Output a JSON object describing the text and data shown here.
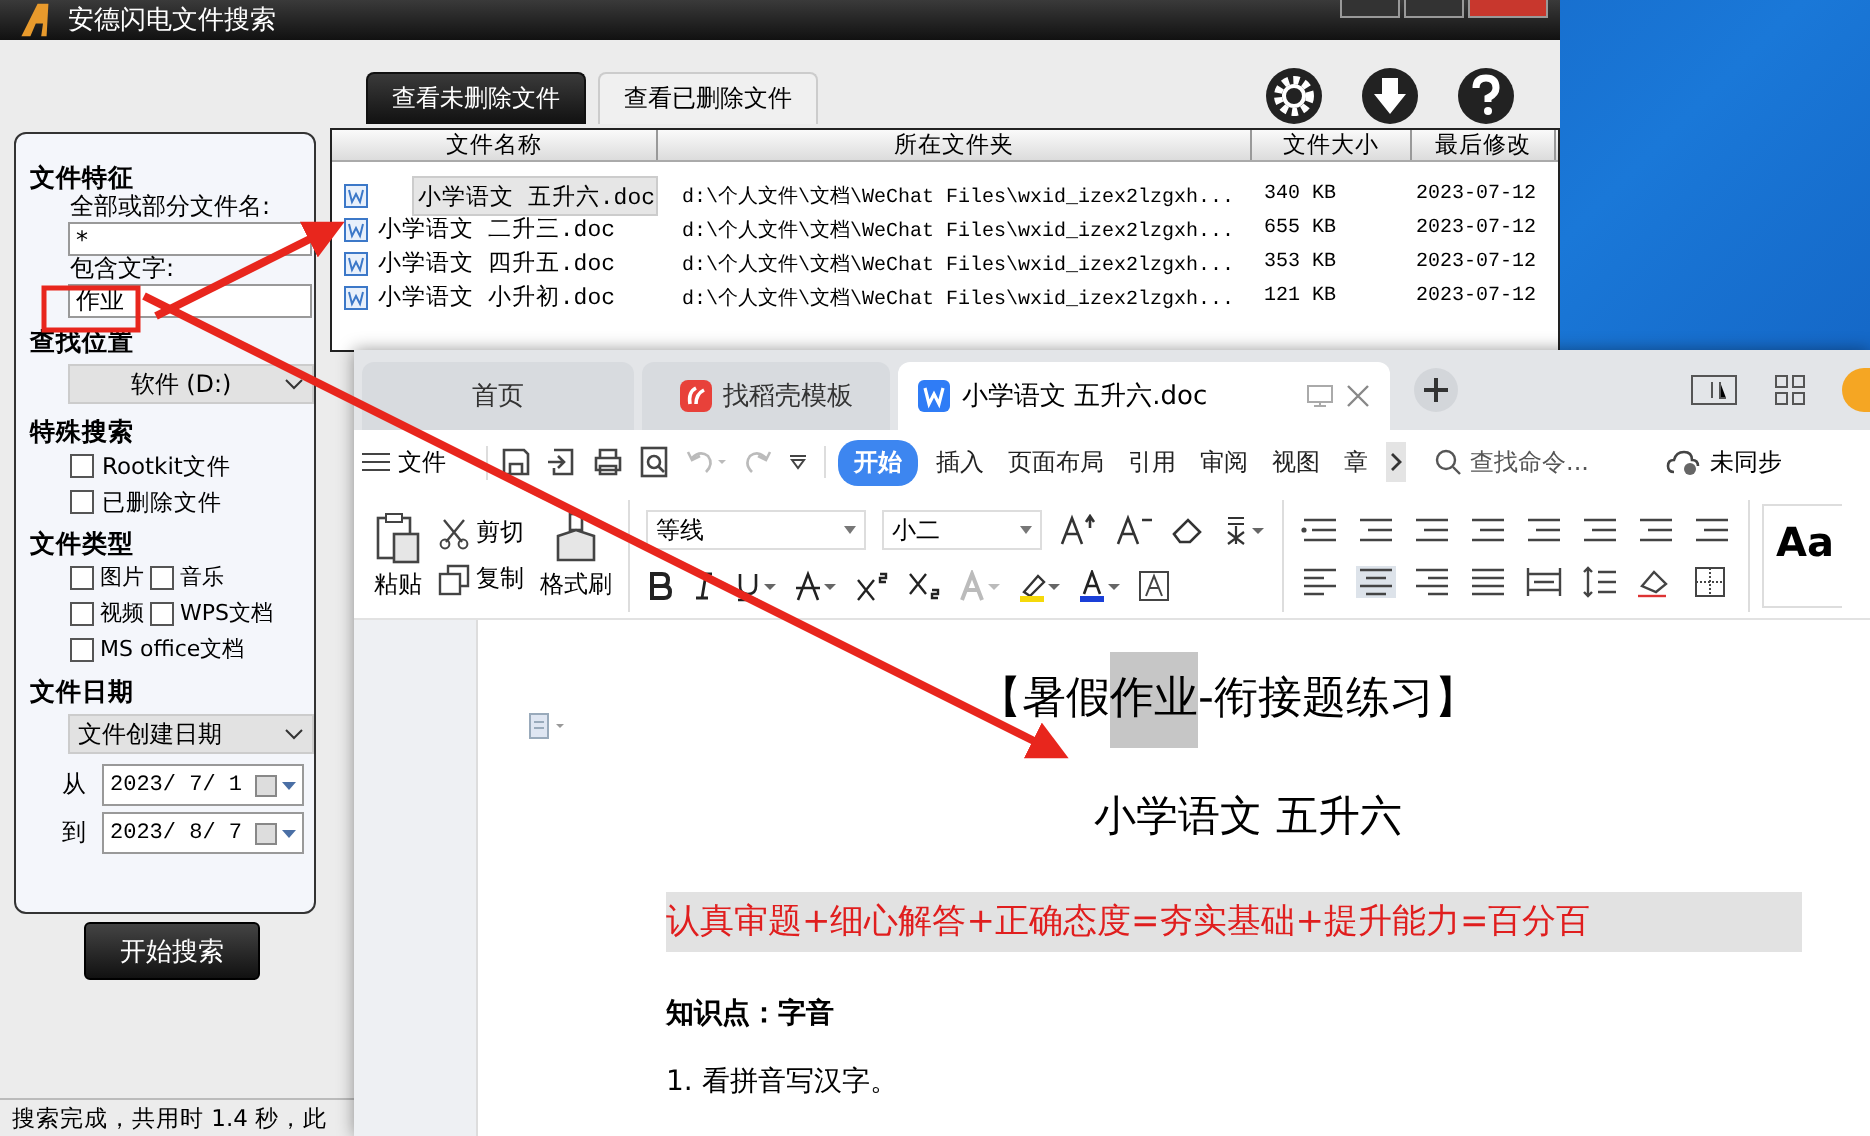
{
  "search_app": {
    "title": "安德闪电文件搜索",
    "file_features": {
      "heading": "文件特征",
      "name_label": "全部或部分文件名:",
      "name_value": "*",
      "text_label": "包含文字:",
      "text_value": "作业"
    },
    "location": {
      "heading": "查找位置",
      "value": "软件 (D:)"
    },
    "special": {
      "heading": "特殊搜索",
      "options": [
        {
          "label": "Rootkit文件",
          "checked": false
        },
        {
          "label": "已删除文件",
          "checked": false
        }
      ]
    },
    "types": {
      "heading": "文件类型",
      "options": [
        {
          "label": "图片",
          "checked": false
        },
        {
          "label": "音乐",
          "checked": false
        },
        {
          "label": "视频",
          "checked": false
        },
        {
          "label": "WPS文档",
          "checked": false
        },
        {
          "label": "MS office文档",
          "checked": false
        }
      ]
    },
    "date": {
      "heading": "文件日期",
      "mode": "文件创建日期",
      "from_label": "从",
      "from": "2023/ 7/ 1",
      "to_label": "到",
      "to": "2023/ 8/ 7"
    },
    "start_button": "开始搜索",
    "tabs": [
      {
        "label": "查看未删除文件",
        "selected": true
      },
      {
        "label": "查看已删除文件",
        "selected": false
      }
    ],
    "table": {
      "columns": [
        "文件名称",
        "所在文件夹",
        "文件大小",
        "最后修改"
      ],
      "rows": [
        {
          "selected": true,
          "cells": [
            "小学语文 五升六.doc",
            "d:\\个人文件\\文档\\WeChat Files\\wxid_izex2lzgxh...",
            "340 KB",
            "2023-07-12"
          ]
        },
        {
          "selected": false,
          "cells": [
            "小学语文 二升三.doc",
            "d:\\个人文件\\文档\\WeChat Files\\wxid_izex2lzgxh...",
            "655 KB",
            "2023-07-12"
          ]
        },
        {
          "selected": false,
          "cells": [
            "小学语文 四升五.doc",
            "d:\\个人文件\\文档\\WeChat Files\\wxid_izex2lzgxh...",
            "353 KB",
            "2023-07-12"
          ]
        },
        {
          "selected": false,
          "cells": [
            "小学语文 小升初.doc",
            "d:\\个人文件\\文档\\WeChat Files\\wxid_izex2lzgxh...",
            "121 KB",
            "2023-07-12"
          ]
        }
      ]
    },
    "status_bar": "搜索完成，共用时 1.4 秒，此"
  },
  "wps": {
    "tabs": [
      {
        "label": "首页",
        "kind": "home",
        "selected": false
      },
      {
        "label": "找稻壳模板",
        "kind": "template",
        "selected": false
      },
      {
        "label": "小学语文 五升六.doc",
        "kind": "doc",
        "selected": true
      }
    ],
    "menu_label": "文件",
    "ribbon_tabs": [
      {
        "label": "开始",
        "selected": true
      },
      {
        "label": "插入",
        "selected": false
      },
      {
        "label": "页面布局",
        "selected": false
      },
      {
        "label": "引用",
        "selected": false
      },
      {
        "label": "审阅",
        "selected": false
      },
      {
        "label": "视图",
        "selected": false
      },
      {
        "label": "章",
        "selected": false
      }
    ],
    "search_placeholder": "查找命令...",
    "sync": "未同步",
    "clipboard": {
      "paste": "粘贴",
      "cut": "剪切",
      "copy": "复制",
      "format_painter": "格式刷"
    },
    "font": "等线",
    "size": "小二",
    "style_preview": "Aa",
    "document": {
      "title": [
        {
          "text": "【暑假",
          "highlighted": false
        },
        {
          "text": "作业",
          "highlighted": true
        },
        {
          "text": "-衔接题练习】",
          "highlighted": false
        }
      ],
      "subtitle": "小学语文  五升六",
      "motto": "认真审题+细心解答+正确态度=夯实基础+提升能力=百分百",
      "section": "知识点：字音",
      "item": "1.   看拼音写汉字。"
    }
  }
}
